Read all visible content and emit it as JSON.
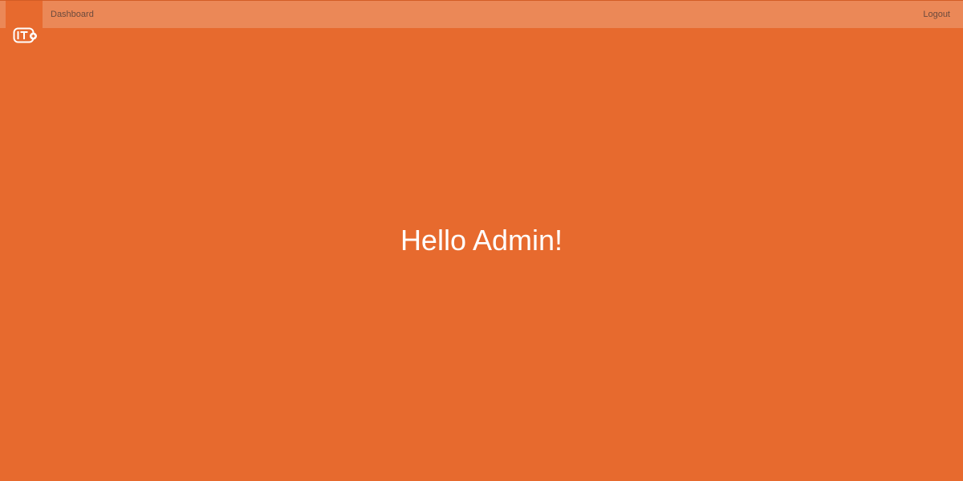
{
  "nav": {
    "dashboard_label": "Dashboard",
    "logout_label": "Logout"
  },
  "logo": {
    "icon": "it-logo-icon"
  },
  "main": {
    "greeting": "Hello Admin!"
  },
  "colors": {
    "background": "#E76A2E",
    "topbar": "#EB8857",
    "text": "#FFFFFF"
  }
}
